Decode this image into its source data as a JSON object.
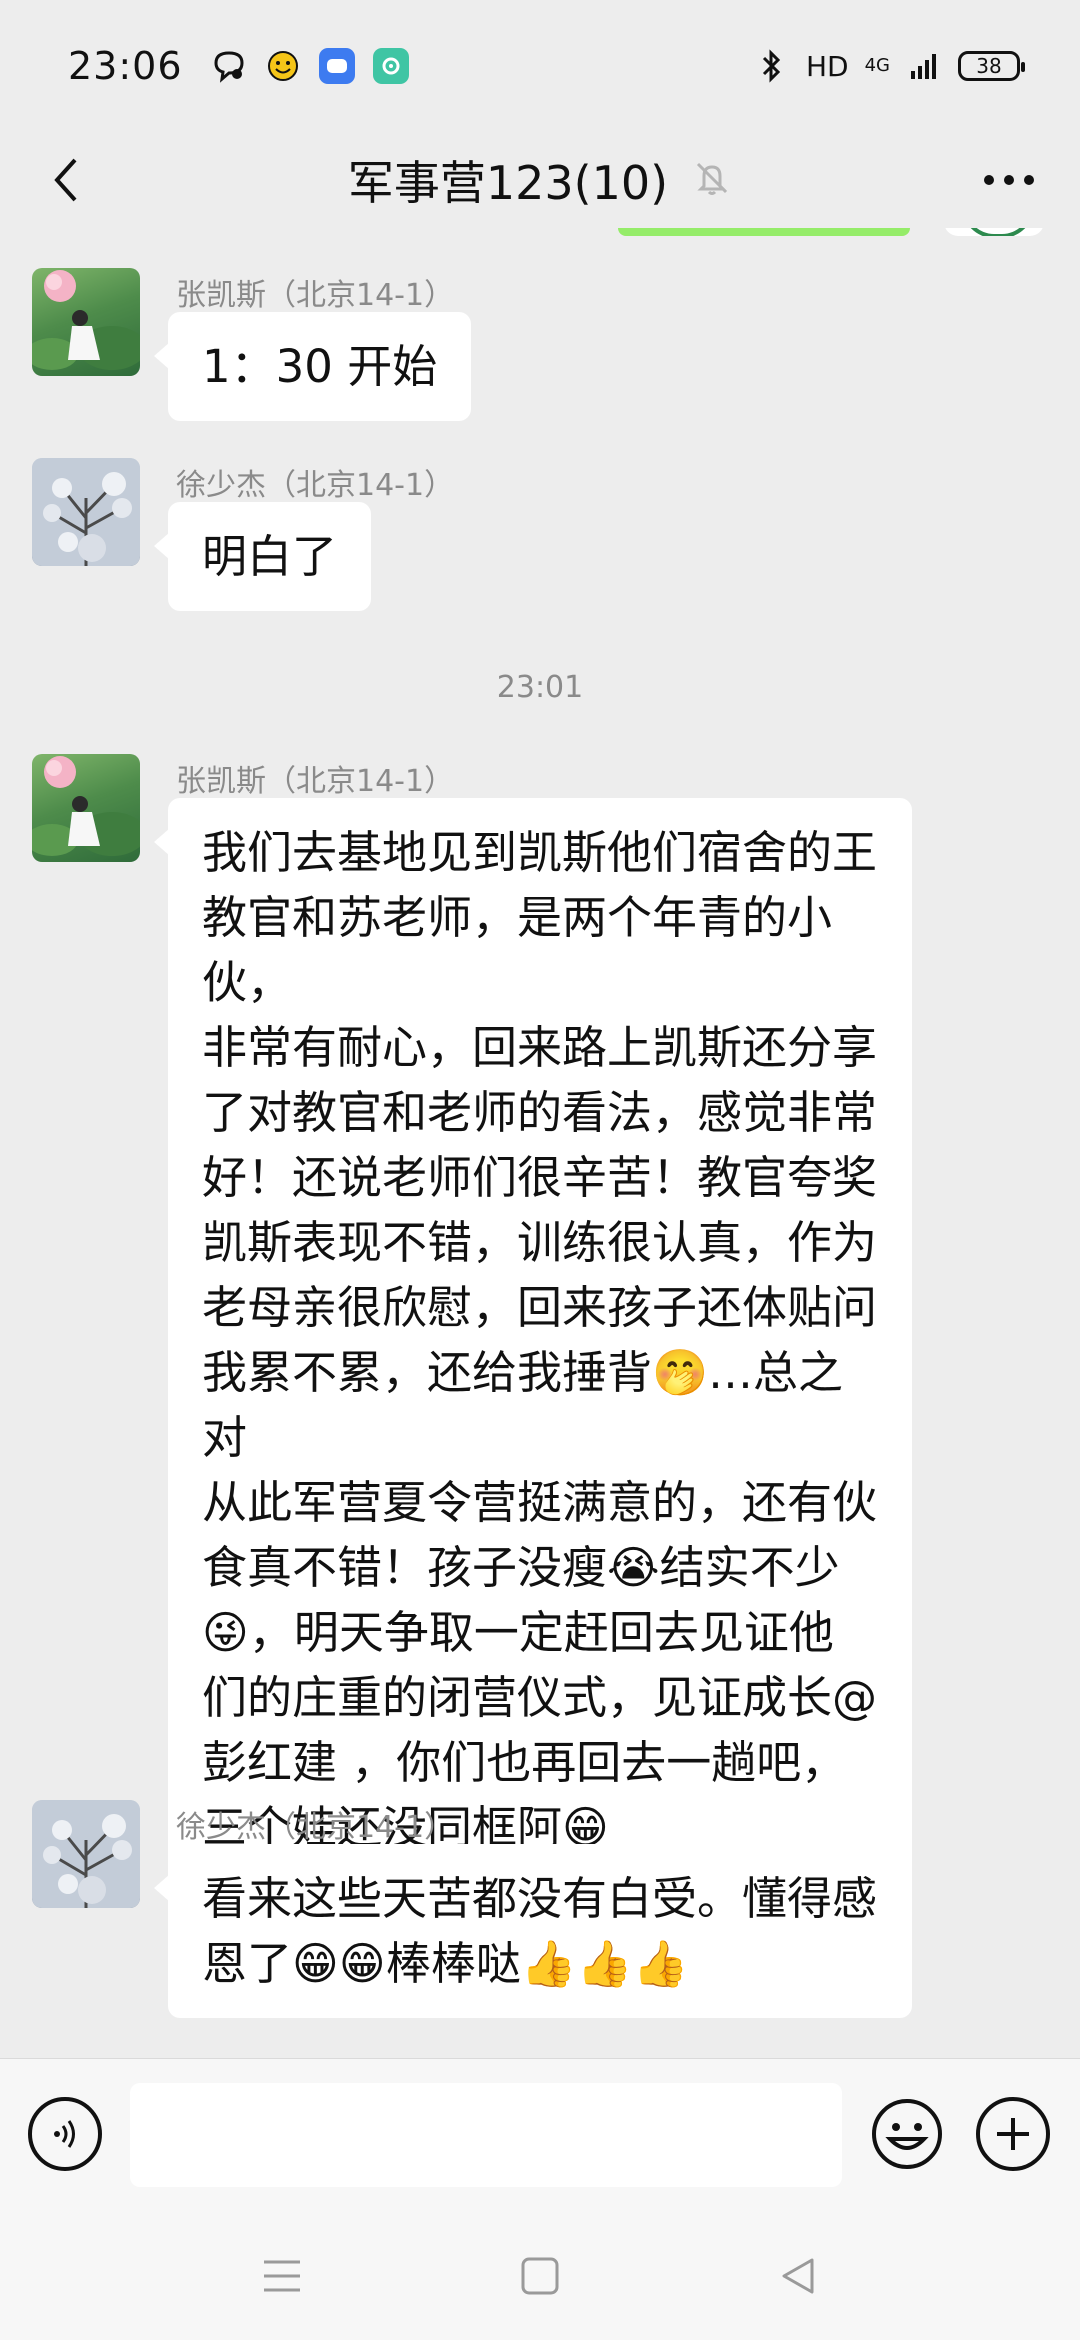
{
  "status_bar": {
    "time": "23:06",
    "network": "HD",
    "signal": "4G",
    "battery": "38",
    "icons": [
      "chat-bubble-icon",
      "emoji-face-icon",
      "blue-app-icon",
      "green-app-icon",
      "bluetooth-icon",
      "signal-bars-icon"
    ]
  },
  "header": {
    "title": "军事营123(10)",
    "muted_icon": "bell-muted-icon"
  },
  "messages": [
    {
      "sender": "张凯斯（北京14-1）",
      "avatar": "lotus-girl-avatar",
      "text": "1：30 开始"
    },
    {
      "sender": "徐少杰（北京14-1）",
      "avatar": "winter-tree-avatar",
      "text": "明白了"
    }
  ],
  "time_separator": "23:01",
  "long_message": {
    "sender": "张凯斯（北京14-1）",
    "avatar": "lotus-girl-avatar",
    "lines": [
      "我们去基地见到凯斯他们宿舍的王",
      "教官和苏老师，是两个年青的小伙，",
      "非常有耐心，回来路上凯斯还分享",
      "了对教官和老师的看法，感觉非常",
      "好！还说老师们很辛苦！教官夸奖",
      "凯斯表现不错，训练很认真，作为",
      "老母亲很欣慰，回来孩子还体贴问",
      "我累不累，还给我捶背🤭…总之对",
      "从此军营夏令营挺满意的，还有伙",
      "食真不错！孩子没瘦😭结实不少",
      "😜，明天争取一定赶回去见证他",
      "们的庄重的闭营仪式，见证成长@",
      "彭红建 ，你们也再回去一趟吧，",
      "三个娃还没同框阿😁"
    ]
  },
  "last_message": {
    "sender": "徐少杰（北京14-1）",
    "avatar": "winter-tree-avatar",
    "lines": [
      "看来这些天苦都没有白受。懂得感",
      "恩了😁😁棒棒哒👍👍👍"
    ]
  },
  "input_bar": {
    "placeholder": "",
    "icons": [
      "voice-icon",
      "emoji-icon",
      "plus-icon"
    ]
  },
  "nav_bar": {
    "icons": [
      "menu-icon",
      "home-square-icon",
      "back-triangle-icon"
    ]
  },
  "colors": {
    "background": "#ededed",
    "bubble": "#ffffff",
    "self_bubble": "#95ec69",
    "meta_text": "#8a8a8a"
  }
}
